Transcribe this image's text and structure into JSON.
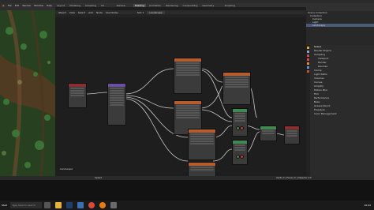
{
  "app": {
    "title": "Blender",
    "menu": [
      "File",
      "Edit",
      "Render",
      "Window",
      "Help"
    ],
    "workspaces": [
      "Layout",
      "Modeling",
      "Sculpting",
      "UV Editing",
      "Texture Paint",
      "Shading",
      "Animation",
      "Rendering",
      "Compositing",
      "Geometry Nodes",
      "Scripting"
    ],
    "active_workspace": "Shading"
  },
  "node_editor": {
    "header_items": [
      "Object",
      "View",
      "Select",
      "Add",
      "Node",
      "Use Nodes"
    ],
    "slot": "Slot 1",
    "material": "Landscape",
    "footer_label": "Landscape"
  },
  "outliner": {
    "rows": [
      "Scene Collection",
      "Collection",
      "Camera",
      "Light",
      "Landscape"
    ],
    "selected_index": 4
  },
  "properties": {
    "title": "Scene",
    "rows": [
      "Render Engine",
      "Sampling",
      "Viewport",
      "Render",
      "Denoise",
      "Clamp",
      "Light Paths",
      "Volumes",
      "Curves",
      "Simplify",
      "Motion Blur",
      "Film",
      "Performance",
      "Bake",
      "Grease Pencil",
      "Freestyle",
      "Color Management"
    ]
  },
  "statusbar": {
    "left": "Select",
    "right": "Verts 0 | Faces 0 | Objects 1/3"
  },
  "taskbar": {
    "start": "Start",
    "search": "Type here to search",
    "clock": "10:42"
  },
  "colors": {
    "accent": "#4772b3",
    "node_texture": "#b55d2f",
    "node_shader": "#3f8a4f",
    "node_vector": "#6a4fa3",
    "node_input": "#8a2f2f"
  }
}
